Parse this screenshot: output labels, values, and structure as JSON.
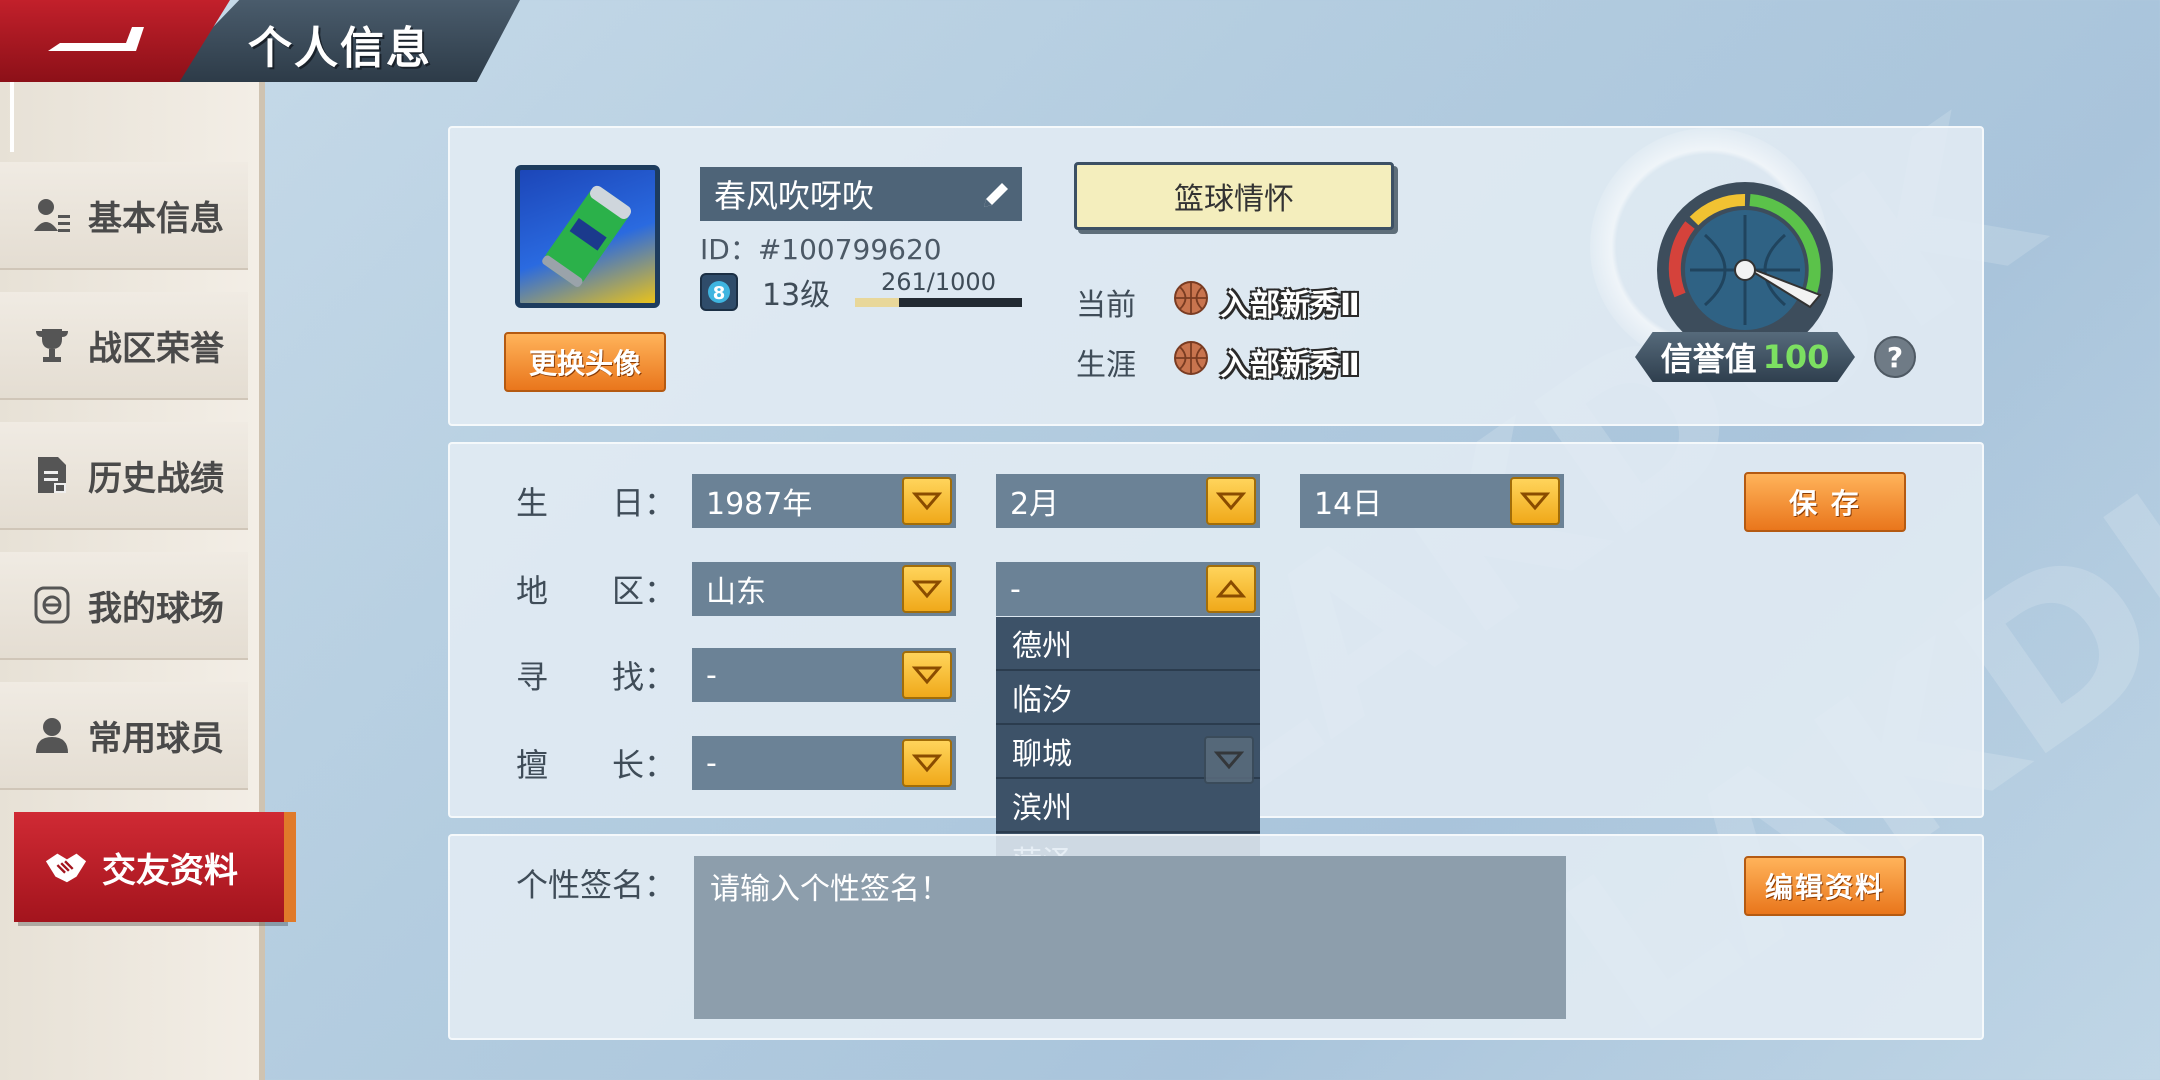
{
  "header": {
    "title": "个人信息"
  },
  "sidebar": {
    "items": [
      {
        "label": "基本信息"
      },
      {
        "label": "战区荣誉"
      },
      {
        "label": "历史战绩"
      },
      {
        "label": "我的球场"
      },
      {
        "label": "常用球员"
      },
      {
        "label": "交友资料"
      }
    ],
    "active": "交友资料"
  },
  "profile": {
    "nickname": "春风吹呀吹",
    "id_text": "ID：#100799620",
    "level_text": "13级",
    "level_badge": "8",
    "exp_text": "261/1000",
    "exp_fraction": 0.261,
    "change_avatar_label": "更换头像",
    "title_button": "篮球情怀",
    "current_label": "当前",
    "current_rank": "入部新秀Ⅱ",
    "career_label": "生涯",
    "career_rank": "入部新秀Ⅱ",
    "credit_label": "信誉值",
    "credit_value": "100",
    "help": "?"
  },
  "form": {
    "birthday_label": "生　　日：",
    "year": "1987年",
    "month": "2月",
    "day": "14日",
    "region_label": "地　　区：",
    "province": "山东",
    "city": "-",
    "seek_label": "寻　　找：",
    "seek": "-",
    "skill_label": "擅　　长：",
    "skill": "-",
    "save_label": "保 存",
    "city_options": [
      "德州",
      "临汐",
      "聊城",
      "滨州",
      "菏泽"
    ]
  },
  "signature": {
    "label": "个性签名：",
    "placeholder": "请输入个性签名！",
    "edit_label": "编辑资料"
  },
  "colors": {
    "accent_red": "#c2202b",
    "button_orange": "#e9761c",
    "credit_green": "#7ce061"
  }
}
